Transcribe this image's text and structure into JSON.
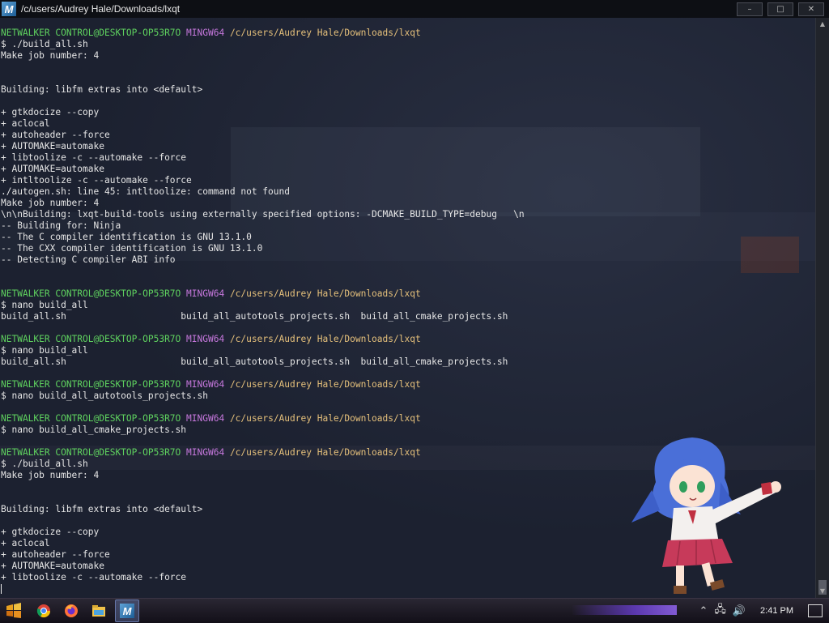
{
  "window": {
    "title": "/c/users/Audrey Hale/Downloads/lxqt",
    "app_icon_letter": "M",
    "buttons": {
      "minimize": "–",
      "maximize": "□",
      "close": "✕"
    }
  },
  "terminal": {
    "lines": [
      {
        "kind": "prompt",
        "user": "NETWALKER CONTROL@DESKTOP-OP53R7O",
        "mingw": "MINGW64",
        "path": "/c/users/Audrey Hale/Downloads/lxqt"
      },
      {
        "kind": "text",
        "text": "$ ./build_all.sh"
      },
      {
        "kind": "text",
        "text": "Make job number: 4"
      },
      {
        "kind": "text",
        "text": ""
      },
      {
        "kind": "text",
        "text": ""
      },
      {
        "kind": "text",
        "text": "Building: libfm extras into <default>"
      },
      {
        "kind": "text",
        "text": ""
      },
      {
        "kind": "text",
        "text": "+ gtkdocize --copy"
      },
      {
        "kind": "text",
        "text": "+ aclocal"
      },
      {
        "kind": "text",
        "text": "+ autoheader --force"
      },
      {
        "kind": "text",
        "text": "+ AUTOMAKE=automake"
      },
      {
        "kind": "text",
        "text": "+ libtoolize -c --automake --force"
      },
      {
        "kind": "text",
        "text": "+ AUTOMAKE=automake"
      },
      {
        "kind": "text",
        "text": "+ intltoolize -c --automake --force"
      },
      {
        "kind": "text",
        "text": "./autogen.sh: line 45: intltoolize: command not found"
      },
      {
        "kind": "text",
        "text": "Make job number: 4"
      },
      {
        "kind": "text",
        "text": "\\n\\nBuilding: lxqt-build-tools using externally specified options: -DCMAKE_BUILD_TYPE=debug   \\n"
      },
      {
        "kind": "text",
        "text": "-- Building for: Ninja"
      },
      {
        "kind": "text",
        "text": "-- The C compiler identification is GNU 13.1.0"
      },
      {
        "kind": "text",
        "text": "-- The CXX compiler identification is GNU 13.1.0"
      },
      {
        "kind": "text",
        "text": "-- Detecting C compiler ABI info"
      },
      {
        "kind": "text",
        "text": ""
      },
      {
        "kind": "text",
        "text": ""
      },
      {
        "kind": "prompt",
        "user": "NETWALKER CONTROL@DESKTOP-OP53R7O",
        "mingw": "MINGW64",
        "path": "/c/users/Audrey Hale/Downloads/lxqt"
      },
      {
        "kind": "text",
        "text": "$ nano build_all"
      },
      {
        "kind": "text",
        "text": "build_all.sh                     build_all_autotools_projects.sh  build_all_cmake_projects.sh"
      },
      {
        "kind": "text",
        "text": ""
      },
      {
        "kind": "prompt",
        "user": "NETWALKER CONTROL@DESKTOP-OP53R7O",
        "mingw": "MINGW64",
        "path": "/c/users/Audrey Hale/Downloads/lxqt"
      },
      {
        "kind": "text",
        "text": "$ nano build_all"
      },
      {
        "kind": "text",
        "text": "build_all.sh                     build_all_autotools_projects.sh  build_all_cmake_projects.sh"
      },
      {
        "kind": "text",
        "text": ""
      },
      {
        "kind": "prompt",
        "user": "NETWALKER CONTROL@DESKTOP-OP53R7O",
        "mingw": "MINGW64",
        "path": "/c/users/Audrey Hale/Downloads/lxqt"
      },
      {
        "kind": "text",
        "text": "$ nano build_all_autotools_projects.sh"
      },
      {
        "kind": "text",
        "text": ""
      },
      {
        "kind": "prompt",
        "user": "NETWALKER CONTROL@DESKTOP-OP53R7O",
        "mingw": "MINGW64",
        "path": "/c/users/Audrey Hale/Downloads/lxqt"
      },
      {
        "kind": "text",
        "text": "$ nano build_all_cmake_projects.sh"
      },
      {
        "kind": "text",
        "text": ""
      },
      {
        "kind": "prompt",
        "user": "NETWALKER CONTROL@DESKTOP-OP53R7O",
        "mingw": "MINGW64",
        "path": "/c/users/Audrey Hale/Downloads/lxqt"
      },
      {
        "kind": "text",
        "text": "$ ./build_all.sh"
      },
      {
        "kind": "text",
        "text": "Make job number: 4"
      },
      {
        "kind": "text",
        "text": ""
      },
      {
        "kind": "text",
        "text": ""
      },
      {
        "kind": "text",
        "text": "Building: libfm extras into <default>"
      },
      {
        "kind": "text",
        "text": ""
      },
      {
        "kind": "text",
        "text": "+ gtkdocize --copy"
      },
      {
        "kind": "text",
        "text": "+ aclocal"
      },
      {
        "kind": "text",
        "text": "+ autoheader --force"
      },
      {
        "kind": "text",
        "text": "+ AUTOMAKE=automake"
      },
      {
        "kind": "text",
        "text": "+ libtoolize -c --automake --force"
      },
      {
        "kind": "cursor"
      }
    ]
  },
  "taskbar": {
    "clock": "2:41 PM",
    "apps": [
      "start-icon",
      "chrome-icon",
      "firefox-icon",
      "file-explorer-icon",
      "msys2-terminal-icon"
    ],
    "active_app": "msys2-terminal-icon",
    "tray": [
      "chevron-up-icon",
      "network-icon",
      "volume-icon",
      "notification-icon"
    ]
  },
  "colors": {
    "prompt_user": "#5fd35f",
    "prompt_mingw": "#c678dd",
    "prompt_path": "#e5c07b",
    "text": "#e6e6e6",
    "terminal_bg": "#1c2130"
  }
}
